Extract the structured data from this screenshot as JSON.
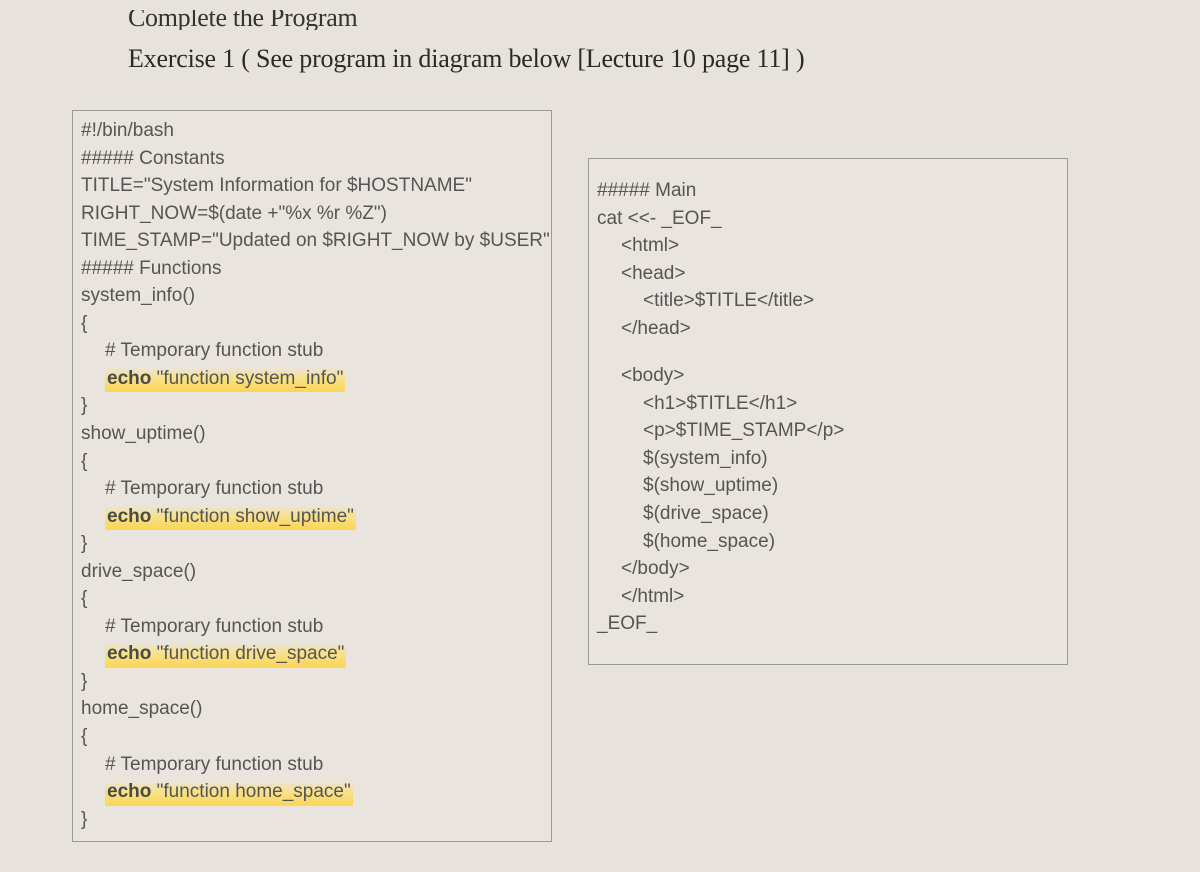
{
  "header_partial": "Complete the Program",
  "exercise_title": "Exercise 1 ( See program in diagram below [Lecture 10 page 11] )",
  "left_code": {
    "l01": "#!/bin/bash",
    "l02": "##### Constants",
    "l03": "TITLE=\"System Information for $HOSTNAME\"",
    "l04": "RIGHT_NOW=$(date +\"%x %r %Z\")",
    "l05": "TIME_STAMP=\"Updated on $RIGHT_NOW by $USER\"",
    "l06": "##### Functions",
    "l07": "system_info()",
    "l08": "{",
    "l09a": "# Temporary function stub",
    "l09b_kw": "echo",
    "l09b_str": " \"function system_info\"",
    "l10": "}",
    "l11": "show_uptime()",
    "l12": "{",
    "l13a": "# Temporary function stub",
    "l13b_kw": "echo",
    "l13b_str": " \"function show_uptime\"",
    "l14": "}",
    "l15": "drive_space()",
    "l16": "{",
    "l17a": "# Temporary function stub",
    "l17b_kw": "echo",
    "l17b_str": " \"function drive_space\"",
    "l18": "}",
    "l19": "home_space()",
    "l20": "{",
    "l21a": "# Temporary function stub",
    "l21b_kw": "echo",
    "l21b_str": " \"function home_space\"",
    "l22": "}"
  },
  "right_code": {
    "r01": "##### Main",
    "r02": "cat <<- _EOF_",
    "r03": "<html>",
    "r04": "<head>",
    "r05": "<title>$TITLE</title>",
    "r06": "</head>",
    "r08": "<body>",
    "r09": "<h1>$TITLE</h1>",
    "r10": "<p>$TIME_STAMP</p>",
    "r11": "$(system_info)",
    "r12": "$(show_uptime)",
    "r13": "$(drive_space)",
    "r14": "$(home_space)",
    "r15": "</body>",
    "r16": "</html>",
    "r17": "_EOF_"
  }
}
